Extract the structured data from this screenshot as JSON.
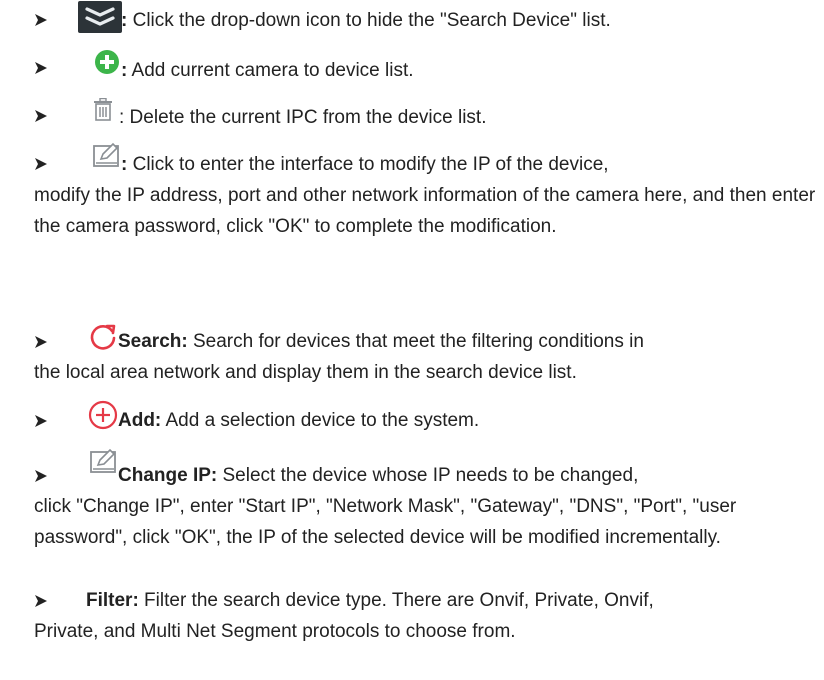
{
  "items": [
    {
      "icon": "chevron-double-down-icon",
      "label": ":",
      "text": " Click the drop-down icon to hide the \"Search Device\" list."
    },
    {
      "icon": "green-plus-circle-icon",
      "label": ":",
      "text": " Add current camera to device list."
    },
    {
      "icon": "trash-icon",
      "label": "",
      "text": ": Delete the current IPC from the device list."
    },
    {
      "icon": "edit-icon",
      "label": ":",
      "text_line1": " Click to enter the interface to modify the IP of the device,",
      "text_rest": "modify the IP address, port and other network information of the camera here, and then enter the camera password, click \"OK\" to complete the modification."
    },
    {
      "icon": "refresh-icon",
      "label": "Search:",
      "text_line1": " Search for devices that meet the filtering conditions in",
      "text_rest": "the local area network and display them in the search device list."
    },
    {
      "icon": "red-plus-circle-icon",
      "label": "Add:",
      "text": " Add a selection device to the system."
    },
    {
      "icon": "edit-icon",
      "label": "Change IP:",
      "text_line1": " Select the device whose IP needs to be changed,",
      "text_rest": "click \"Change IP\", enter \"Start IP\", \"Network Mask\", \"Gateway\", \"DNS\", \"Port\", \"user password\", click \"OK\", the IP of the selected device will be modified incrementally."
    },
    {
      "icon": "",
      "label": "Filter:",
      "text_line1": " Filter the search device type. There are Onvif, Private, Onvif,",
      "text_rest": "Private, and Multi Net Segment protocols to choose from."
    }
  ],
  "colors": {
    "text": "#222222",
    "green": "#3cb54a",
    "red": "#e53946",
    "dark_icon_bg": "#2c3338",
    "gray_icon": "#8a8f94"
  }
}
